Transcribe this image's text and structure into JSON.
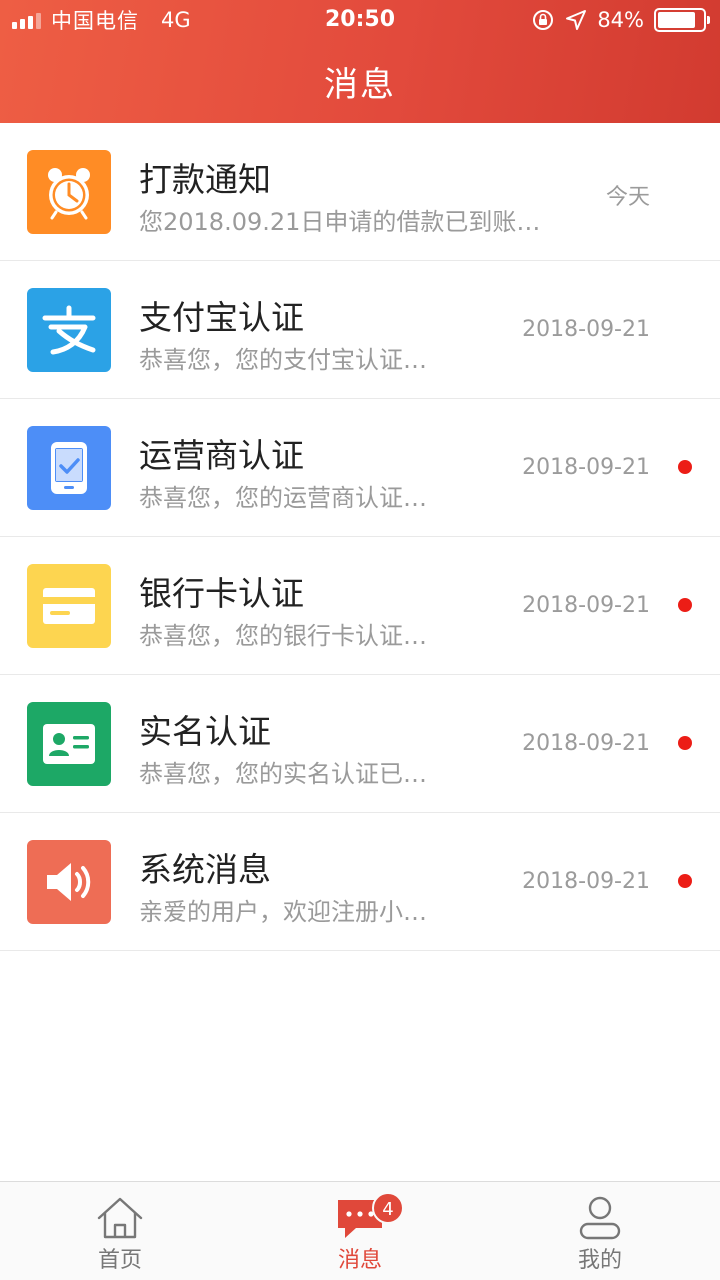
{
  "status_bar": {
    "carrier": "中国电信",
    "network": "4G",
    "time": "20:50",
    "battery": "84%",
    "battery_level": 0.84
  },
  "header": {
    "title": "消息"
  },
  "messages": [
    {
      "title": "打款通知",
      "subtitle": "您2018.09.21日申请的借款已到账…",
      "date": "今天",
      "unread": false,
      "icon": "alarm-clock-icon",
      "color": "#ff8c25"
    },
    {
      "title": "支付宝认证",
      "subtitle": "恭喜您，您的支付宝认证…",
      "date": "2018-09-21",
      "unread": false,
      "icon": "alipay-icon",
      "color": "#2ba2e6"
    },
    {
      "title": "运营商认证",
      "subtitle": "恭喜您，您的运营商认证…",
      "date": "2018-09-21",
      "unread": true,
      "icon": "phone-check-icon",
      "color": "#4d8ef7"
    },
    {
      "title": "银行卡认证",
      "subtitle": "恭喜您，您的银行卡认证…",
      "date": "2018-09-21",
      "unread": true,
      "icon": "bank-card-icon",
      "color": "#fdd550"
    },
    {
      "title": "实名认证",
      "subtitle": "恭喜您，您的实名认证已…",
      "date": "2018-09-21",
      "unread": true,
      "icon": "id-card-icon",
      "color": "#1da866"
    },
    {
      "title": "系统消息",
      "subtitle": "亲爱的用户，欢迎注册小…",
      "date": "2018-09-21",
      "unread": true,
      "icon": "speaker-icon",
      "color": "#ee6d55"
    }
  ],
  "tabbar": {
    "tabs": [
      {
        "label": "首页",
        "icon": "home-icon",
        "active": false
      },
      {
        "label": "消息",
        "icon": "chat-bubble-icon",
        "active": true,
        "badge": "4"
      },
      {
        "label": "我的",
        "icon": "user-icon",
        "active": false
      }
    ]
  },
  "colors": {
    "accent": "#e0483a",
    "unread_dot": "#ec1d16"
  }
}
